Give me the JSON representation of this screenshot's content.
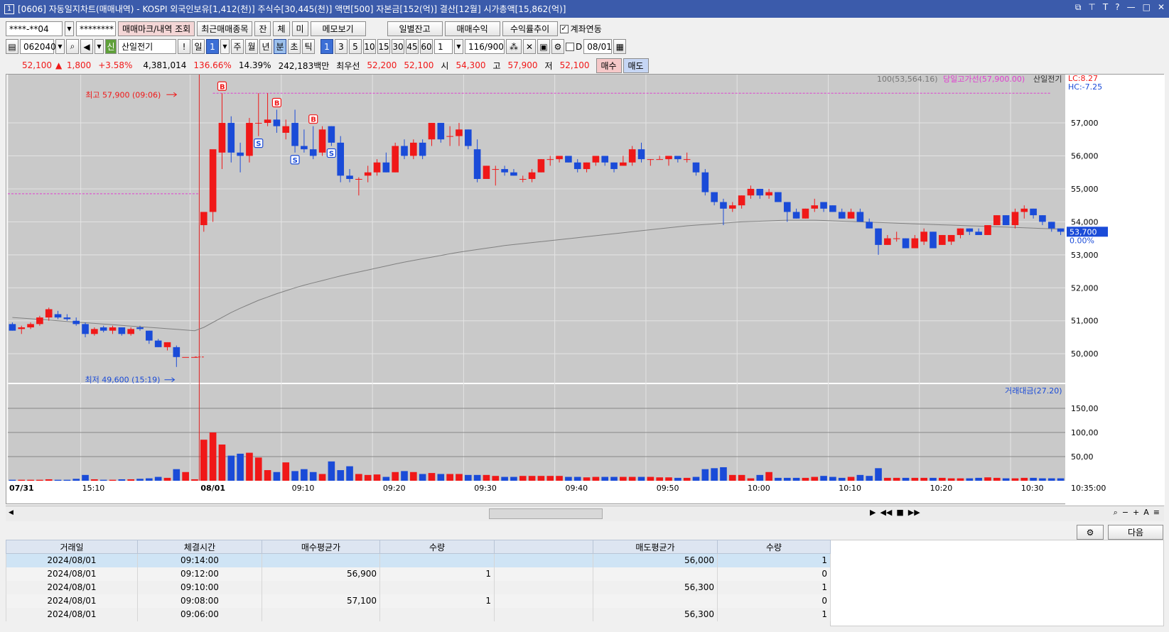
{
  "title": {
    "num": "1",
    "text": "[0606] 자동일지차트(매매내역) - KOSPI 외국인보유[1,412(천)] 주식수[30,445(천)] 액면[500] 자본금[152(억)] 결산[12월] 시가총액[15,862(억)]"
  },
  "toolbar1": {
    "account": "****-**04",
    "password": "********",
    "btn_trade_mark": "매매마크/내역 조회",
    "btn_recent": "최근매매종목",
    "btn_jan": "잔",
    "btn_che": "체",
    "btn_mi": "미",
    "btn_memo": "메모보기",
    "btn_daily": "일별잔고",
    "btn_profit": "매매수익",
    "btn_rate": "수익률추이",
    "checkbox_label": "계좌연동"
  },
  "toolbar2": {
    "code": "062040",
    "stock_name": "산일전기",
    "prefix": "신",
    "period_il": "일",
    "period_num": "1",
    "tabs": [
      "주",
      "월",
      "년",
      "분",
      "초",
      "틱"
    ],
    "minutes": [
      "1",
      "3",
      "5",
      "10",
      "15",
      "30",
      "45",
      "60"
    ],
    "count_sel": "1",
    "bars": "116",
    "max_bars": "/900",
    "date_label": "D",
    "date": "08/01"
  },
  "quote": {
    "price": "52,100",
    "change": "1,800",
    "rate": "+3.58%",
    "volume": "4,381,014",
    "vol_ratio": "136.66%",
    "turnover": "14.39%",
    "amount": "242,183백만",
    "best_label": "최우선",
    "ask": "52,200",
    "bid": "52,100",
    "open_label": "시",
    "open": "54,300",
    "high_label": "고",
    "high": "57,900",
    "low_label": "저",
    "low": "52,100",
    "buy_btn": "매수",
    "sell_btn": "매도"
  },
  "legend": {
    "ma": "100(53,564.16)",
    "high_line": "당일고가선(57,900.00)",
    "stock": "산일전기",
    "lc": "LC:8.27",
    "hc": "HC:-7.25",
    "volume": "거래대금(27.20)"
  },
  "annotations": {
    "high": "최고 57,900 (09:06)",
    "low": "최저 49,600 (15:19)",
    "last_price": "53,700",
    "last_pct": "0.00%"
  },
  "colors": {
    "up": "#f01818",
    "down": "#1a4bd8",
    "ma": "#808080",
    "high_line": "#e040d0",
    "title_bg": "#3b5bab"
  },
  "chart_data": {
    "type": "candlestick",
    "price_axis": {
      "ticks": [
        "57,000",
        "56,000",
        "55,000",
        "54,000",
        "53,000",
        "52,000",
        "51,000",
        "50,000"
      ]
    },
    "volume_axis": {
      "ticks": [
        "150,00",
        "100,00",
        "50,00"
      ]
    },
    "time_axis": [
      "07/31",
      "15:10",
      "08/01",
      "09:10",
      "09:20",
      "09:30",
      "09:40",
      "09:50",
      "10:00",
      "10:10",
      "10:20",
      "10:30",
      "10:35:00"
    ],
    "candles": [
      [
        50900,
        50950,
        50700,
        50700
      ],
      [
        50750,
        50850,
        50600,
        50800
      ],
      [
        50800,
        50950,
        50750,
        50900
      ],
      [
        50900,
        51150,
        50850,
        51100
      ],
      [
        51100,
        51400,
        51000,
        51350
      ],
      [
        51200,
        51300,
        51050,
        51100
      ],
      [
        51100,
        51200,
        51000,
        51050
      ],
      [
        51000,
        51100,
        50850,
        50900
      ],
      [
        50900,
        50950,
        50500,
        50600
      ],
      [
        50600,
        50800,
        50550,
        50750
      ],
      [
        50800,
        50850,
        50650,
        50700
      ],
      [
        50700,
        50850,
        50600,
        50800
      ],
      [
        50800,
        50800,
        50550,
        50600
      ],
      [
        50600,
        50800,
        50550,
        50750
      ],
      [
        50800,
        50850,
        50700,
        50750
      ],
      [
        50700,
        50700,
        50300,
        50400
      ],
      [
        50400,
        50450,
        50200,
        50200
      ],
      [
        50200,
        50350,
        50100,
        50350
      ],
      [
        50200,
        50250,
        49600,
        49900
      ],
      [
        49900,
        49900,
        49900,
        49900
      ],
      [
        49900,
        49900,
        49900,
        49900
      ],
      [
        53900,
        54300,
        53700,
        54300
      ],
      [
        54300,
        55500,
        54000,
        56200
      ],
      [
        56100,
        57900,
        55600,
        57000
      ],
      [
        57000,
        57200,
        55800,
        56100
      ],
      [
        56100,
        56400,
        55500,
        56000
      ],
      [
        56000,
        57150,
        55800,
        57000
      ],
      [
        57000,
        57900,
        56600,
        57000
      ],
      [
        57000,
        57900,
        56900,
        57100
      ],
      [
        57100,
        57400,
        56700,
        56900
      ],
      [
        56700,
        57100,
        56500,
        56900
      ],
      [
        57000,
        57400,
        56100,
        56300
      ],
      [
        56300,
        56800,
        56100,
        56200
      ],
      [
        56200,
        56900,
        55900,
        56000
      ],
      [
        56100,
        56900,
        56000,
        56800
      ],
      [
        56900,
        56900,
        56300,
        56400
      ],
      [
        56400,
        56600,
        55200,
        55400
      ],
      [
        55400,
        55600,
        55200,
        55300
      ],
      [
        55300,
        55350,
        54800,
        55300
      ],
      [
        55400,
        55700,
        55200,
        55500
      ],
      [
        55500,
        55900,
        55400,
        55800
      ],
      [
        55800,
        56100,
        55500,
        55500
      ],
      [
        55500,
        56400,
        55500,
        56300
      ],
      [
        56300,
        56500,
        55900,
        56000
      ],
      [
        56000,
        56500,
        55900,
        56400
      ],
      [
        56400,
        56500,
        55900,
        56000
      ],
      [
        56500,
        57000,
        56300,
        57000
      ],
      [
        57000,
        57000,
        56400,
        56500
      ],
      [
        56600,
        56900,
        56300,
        56600
      ],
      [
        56600,
        57000,
        56300,
        56800
      ],
      [
        56800,
        56800,
        56200,
        56300
      ],
      [
        56200,
        56500,
        55200,
        55300
      ],
      [
        55300,
        55700,
        55300,
        55700
      ],
      [
        55600,
        55700,
        55100,
        55600
      ],
      [
        55600,
        55700,
        55400,
        55500
      ],
      [
        55500,
        55600,
        55400,
        55400
      ],
      [
        55300,
        55400,
        55200,
        55300
      ],
      [
        55300,
        55600,
        55200,
        55500
      ],
      [
        55500,
        55900,
        55500,
        55900
      ],
      [
        55900,
        56000,
        55700,
        55900
      ],
      [
        55900,
        56000,
        55800,
        56000
      ],
      [
        56000,
        56000,
        55800,
        55800
      ],
      [
        55800,
        55900,
        55500,
        55600
      ],
      [
        55600,
        55800,
        55500,
        55800
      ],
      [
        55800,
        56000,
        55700,
        56000
      ],
      [
        56000,
        56000,
        55700,
        55800
      ],
      [
        55800,
        55800,
        55500,
        55600
      ],
      [
        55700,
        56000,
        55700,
        55800
      ],
      [
        55800,
        56300,
        55700,
        56200
      ],
      [
        56200,
        56400,
        55800,
        55900
      ],
      [
        55900,
        55900,
        55700,
        55900
      ],
      [
        55900,
        56000,
        55900,
        55900
      ],
      [
        55900,
        56000,
        55700,
        56000
      ],
      [
        56000,
        56000,
        55800,
        55900
      ],
      [
        55900,
        56100,
        55800,
        55900
      ],
      [
        55800,
        55800,
        55400,
        55500
      ],
      [
        55500,
        55600,
        54800,
        54900
      ],
      [
        54900,
        54900,
        54500,
        54600
      ],
      [
        54600,
        54700,
        53900,
        54400
      ],
      [
        54400,
        54600,
        54300,
        54500
      ],
      [
        54500,
        54800,
        54400,
        54800
      ],
      [
        54800,
        55100,
        54700,
        55000
      ],
      [
        55000,
        55000,
        54700,
        54800
      ],
      [
        54800,
        55000,
        54700,
        54900
      ],
      [
        54900,
        54900,
        54600,
        54600
      ],
      [
        54600,
        54600,
        54000,
        54300
      ],
      [
        54300,
        54400,
        54100,
        54100
      ],
      [
        54100,
        54400,
        54100,
        54400
      ],
      [
        54400,
        54700,
        54300,
        54500
      ],
      [
        54600,
        54600,
        54300,
        54400
      ],
      [
        54500,
        54500,
        54300,
        54300
      ],
      [
        54300,
        54400,
        54100,
        54100
      ],
      [
        54100,
        54400,
        54100,
        54300
      ],
      [
        54300,
        54400,
        54000,
        54000
      ],
      [
        54000,
        54100,
        53800,
        53800
      ],
      [
        53800,
        53800,
        53000,
        53300
      ],
      [
        53300,
        53600,
        53300,
        53500
      ],
      [
        53500,
        53700,
        53400,
        53500
      ],
      [
        53500,
        53500,
        53200,
        53200
      ],
      [
        53200,
        53600,
        53200,
        53500
      ],
      [
        53400,
        53800,
        53300,
        53700
      ],
      [
        53700,
        53700,
        53400,
        53200
      ],
      [
        53300,
        53600,
        53300,
        53600
      ],
      [
        53400,
        53600,
        53300,
        53600
      ],
      [
        53600,
        53800,
        53500,
        53800
      ],
      [
        53800,
        53800,
        53600,
        53700
      ],
      [
        53700,
        53800,
        53600,
        53600
      ],
      [
        53600,
        53900,
        53600,
        53900
      ],
      [
        53900,
        54200,
        53900,
        54200
      ],
      [
        54200,
        54200,
        53900,
        53900
      ],
      [
        53900,
        54400,
        53800,
        54300
      ],
      [
        54300,
        54500,
        54100,
        54400
      ],
      [
        54400,
        54400,
        54100,
        54200
      ],
      [
        54200,
        54200,
        53900,
        54000
      ],
      [
        54000,
        54000,
        53700,
        53800
      ],
      [
        53800,
        53800,
        53600,
        53700
      ]
    ],
    "volumes": [
      2,
      2,
      2,
      2,
      3,
      2,
      2,
      4,
      12,
      3,
      2,
      2,
      3,
      3,
      4,
      5,
      8,
      6,
      24,
      18,
      3,
      85,
      100,
      75,
      52,
      56,
      58,
      48,
      22,
      18,
      38,
      20,
      24,
      18,
      14,
      40,
      22,
      30,
      14,
      12,
      13,
      8,
      18,
      20,
      18,
      14,
      16,
      14,
      14,
      14,
      12,
      12,
      12,
      10,
      8,
      8,
      10,
      10,
      10,
      10,
      10,
      8,
      8,
      7,
      8,
      8,
      8,
      8,
      8,
      8,
      8,
      7,
      7,
      6,
      6,
      8,
      24,
      26,
      28,
      12,
      12,
      5,
      12,
      18,
      6,
      6,
      6,
      6,
      8,
      10,
      8,
      6,
      8,
      12,
      10,
      26,
      6,
      6,
      6,
      6,
      6,
      6,
      6,
      5,
      5,
      5,
      6,
      7,
      6,
      5,
      5,
      6,
      6,
      5,
      5,
      5
    ],
    "trade_marks": [
      {
        "index": 23,
        "type": "B"
      },
      {
        "index": 27,
        "type": "S"
      },
      {
        "index": 29,
        "type": "B"
      },
      {
        "index": 31,
        "type": "S"
      },
      {
        "index": 33,
        "type": "B"
      },
      {
        "index": 35,
        "type": "S"
      }
    ],
    "moving_average": "100(53,564.16)",
    "high_line": 57900
  },
  "table": {
    "headers": [
      "거래일",
      "체결시간",
      "매수평균가",
      "수량",
      "",
      "매도평균가",
      "수량"
    ],
    "rows": [
      [
        "2024/08/01",
        "09:14:00",
        "",
        "",
        "",
        "56,000",
        "1"
      ],
      [
        "2024/08/01",
        "09:12:00",
        "56,900",
        "1",
        "",
        "",
        "0"
      ],
      [
        "2024/08/01",
        "09:10:00",
        "",
        "",
        "",
        "56,300",
        "1"
      ],
      [
        "2024/08/01",
        "09:08:00",
        "57,100",
        "1",
        "",
        "",
        "0"
      ],
      [
        "2024/08/01",
        "09:06:00",
        "",
        "",
        "",
        "56,300",
        "1"
      ]
    ],
    "next_btn": "다음"
  }
}
